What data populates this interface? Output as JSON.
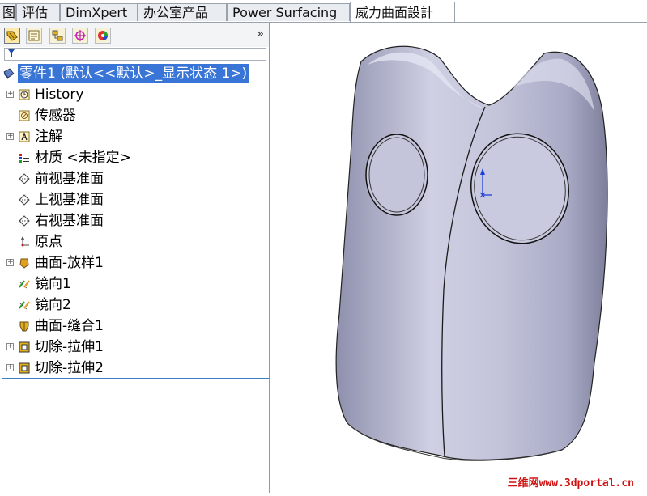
{
  "tabs": [
    {
      "label": "图"
    },
    {
      "label": "评估"
    },
    {
      "label": "DimXpert"
    },
    {
      "label": "办公室产品"
    },
    {
      "label": "Power Surfacing"
    },
    {
      "label": "威力曲面設計"
    }
  ],
  "panel": {
    "toolbar_icons": [
      "feature-manager-icon",
      "property-manager-icon",
      "configuration-manager-icon",
      "dimxpert-manager-icon",
      "display-manager-icon"
    ],
    "expand_glyph": "»",
    "filter_icon": "filter-icon"
  },
  "tree": {
    "root": {
      "label": "零件1  (默认<<默认>_显示状态 1>)",
      "icon": "part-icon"
    },
    "items": [
      {
        "label": "History",
        "icon": "history-icon",
        "expandable": true
      },
      {
        "label": "传感器",
        "icon": "sensor-icon",
        "expandable": false
      },
      {
        "label": "注解",
        "icon": "annotation-icon",
        "expandable": true
      },
      {
        "label": "材质 <未指定>",
        "icon": "material-icon",
        "expandable": false
      },
      {
        "label": "前视基准面",
        "icon": "plane-icon",
        "expandable": false
      },
      {
        "label": "上视基准面",
        "icon": "plane-icon",
        "expandable": false
      },
      {
        "label": "右视基准面",
        "icon": "plane-icon",
        "expandable": false
      },
      {
        "label": "原点",
        "icon": "origin-icon",
        "expandable": false
      },
      {
        "label": "曲面-放样1",
        "icon": "surface-loft-icon",
        "expandable": true
      },
      {
        "label": "镜向1",
        "icon": "mirror-icon",
        "expandable": false
      },
      {
        "label": "镜向2",
        "icon": "mirror-icon",
        "expandable": false
      },
      {
        "label": "曲面-缝合1",
        "icon": "surface-knit-icon",
        "expandable": false
      },
      {
        "label": "切除-拉伸1",
        "icon": "cut-extrude-icon",
        "expandable": true
      },
      {
        "label": "切除-拉伸2",
        "icon": "cut-extrude-icon",
        "expandable": true
      }
    ]
  },
  "viewport": {
    "model": "owl-surface-model",
    "watermark": "三维网www.3dportal.cn"
  },
  "colors": {
    "selection": "#3875d7",
    "model_fill": "#b9bad2",
    "watermark": "#d01010"
  }
}
